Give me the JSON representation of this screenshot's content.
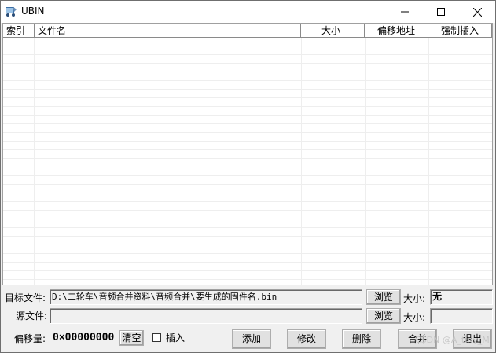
{
  "window": {
    "title": "UBIN",
    "icon": "app-icon",
    "minimize_icon": "minimize-icon",
    "maximize_icon": "maximize-icon",
    "close_icon": "close-icon"
  },
  "table": {
    "columns": [
      "索引",
      "文件名",
      "大小",
      "偏移地址",
      "强制插入"
    ],
    "rows": []
  },
  "target": {
    "label": "目标文件:",
    "value": "D:\\二轮车\\音频合并资料\\音频合并\\要生成的固件名.bin",
    "browse_label": "浏览",
    "size_label": "大小:",
    "size_value": "无"
  },
  "source": {
    "label": "源文件:",
    "value": "",
    "browse_label": "浏览",
    "size_label": "大小:",
    "size_value": ""
  },
  "offset": {
    "label": "偏移量:",
    "value": "0×00000000",
    "clear_label": "清空",
    "insert_label": "插入",
    "insert_checked": false
  },
  "actions": {
    "add": "添加",
    "modify": "修改",
    "delete": "删除",
    "merge": "合并",
    "exit": "退出"
  },
  "watermark": "CSDN @A_tiny_M"
}
